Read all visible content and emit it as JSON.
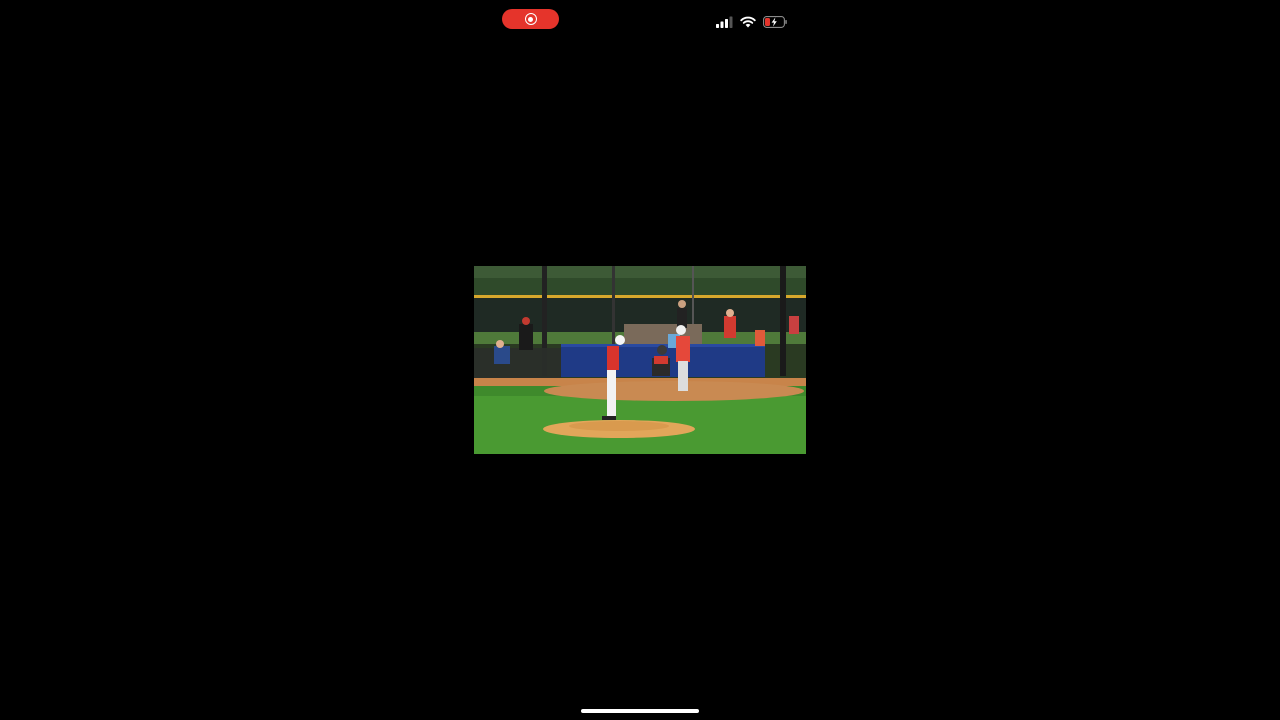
{
  "status_bar": {
    "recording_indicator": "screen-recording",
    "icons": [
      "signal-icon",
      "wifi-icon",
      "battery-charging-icon"
    ],
    "battery_color": "#e5342b",
    "pill_color": "#e5342b"
  },
  "video": {
    "content": "baseball-game-scene"
  },
  "home_indicator": {
    "color": "#ffffff"
  }
}
